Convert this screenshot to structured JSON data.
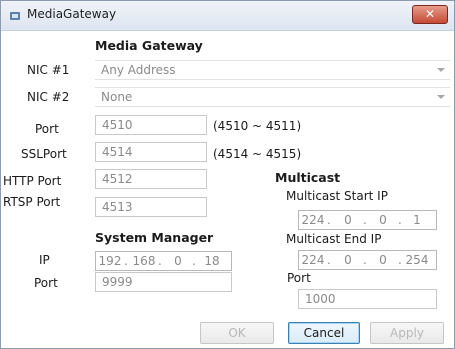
{
  "window": {
    "title": "MediaGateway",
    "close_glyph": "✕"
  },
  "media_gateway": {
    "heading": "Media Gateway",
    "nic1": {
      "label": "NIC #1",
      "value": "Any Address"
    },
    "nic2": {
      "label": "NIC #2",
      "value": "None"
    },
    "port": {
      "label": "Port",
      "value": "4510",
      "range": "(4510 ~ 4511)"
    },
    "sslport": {
      "label": "SSLPort",
      "value": "4514",
      "range": "(4514 ~ 4515)"
    },
    "http_port": {
      "label": "HTTP Port",
      "value": "4512"
    },
    "rtsp_port": {
      "label": "RTSP Port",
      "value": "4513"
    }
  },
  "system_manager": {
    "heading": "System Manager",
    "ip": {
      "label": "IP",
      "octets": [
        "192",
        "168",
        "0",
        "18"
      ]
    },
    "port": {
      "label": "Port",
      "value": "9999"
    }
  },
  "multicast": {
    "heading": "Multicast",
    "start_ip": {
      "label": "Multicast Start IP",
      "octets": [
        "224",
        "0",
        "0",
        "1"
      ]
    },
    "end_ip": {
      "label": "Multicast End IP",
      "octets": [
        "224",
        "0",
        "0",
        "254"
      ]
    },
    "port": {
      "label": "Port",
      "value": "1000"
    }
  },
  "buttons": {
    "ok": "OK",
    "cancel": "Cancel",
    "apply": "Apply"
  }
}
